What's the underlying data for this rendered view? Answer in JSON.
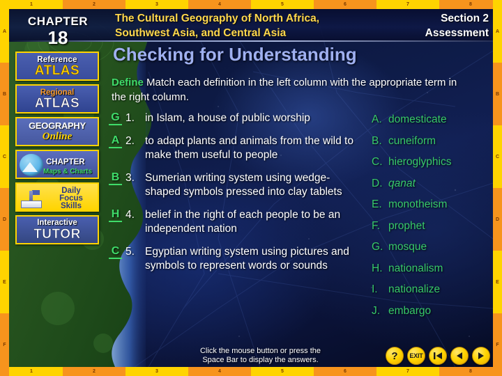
{
  "header": {
    "chapter_word": "CHAPTER",
    "chapter_number": "18",
    "title_line1": "The Cultural Geography of North Africa,",
    "title_line2": "Southwest Asia, and Central Asia",
    "section_line1": "Section 2",
    "section_line2": "Assessment"
  },
  "sidebar": {
    "items": [
      {
        "name": "reference-atlas",
        "line1": "Reference",
        "line2": "ATLAS"
      },
      {
        "name": "regional-atlas",
        "line1": "Regional",
        "line2": "ATLAS"
      },
      {
        "name": "geography-online",
        "line1": "GEOGRAPHY",
        "line2": "Online"
      },
      {
        "name": "chapter-maps-charts",
        "line1": "CHAPTER",
        "line2": "Maps & Charts"
      },
      {
        "name": "daily-focus-skills",
        "line1": "Daily",
        "line2": "Focus",
        "line3": "Skills"
      },
      {
        "name": "interactive-tutor",
        "line1": "Interactive",
        "line2": "TUTOR"
      }
    ]
  },
  "main": {
    "title": "Checking for Understanding",
    "instruction_lead": "Define",
    "instruction_text": "  Match each definition in the left column with the appropriate term in the right column.",
    "definitions": [
      {
        "answer": "G",
        "number": "1.",
        "text": "in Islam, a house of public worship"
      },
      {
        "answer": "A",
        "number": "2.",
        "text": "to adapt plants and animals from the wild to make them useful to people"
      },
      {
        "answer": "B",
        "number": "3.",
        "text": "Sumerian writing system using wedge-shaped symbols pressed into clay tablets"
      },
      {
        "answer": "H",
        "number": "4.",
        "text": "belief in the right of each people to be an independent nation"
      },
      {
        "answer": "C",
        "number": "5.",
        "text": "Egyptian writing system using pictures and symbols to represent words or sounds"
      }
    ],
    "terms": [
      {
        "letter": "A.",
        "term": "domesticate",
        "italic": false
      },
      {
        "letter": "B.",
        "term": "cuneiform",
        "italic": false
      },
      {
        "letter": "C.",
        "term": "hieroglyphics",
        "italic": false
      },
      {
        "letter": "D.",
        "term": "qanat",
        "italic": true
      },
      {
        "letter": "E.",
        "term": "monotheism",
        "italic": false
      },
      {
        "letter": "F.",
        "term": "prophet",
        "italic": false
      },
      {
        "letter": "G.",
        "term": "mosque",
        "italic": false
      },
      {
        "letter": "H.",
        "term": "nationalism",
        "italic": false
      },
      {
        "letter": "I.",
        "term": "nationalize",
        "italic": false
      },
      {
        "letter": "J.",
        "term": "embargo",
        "italic": false
      }
    ]
  },
  "footer": {
    "hint_line1": "Click the mouse button or press the",
    "hint_line2": "Space Bar to display the answers.",
    "nav": [
      {
        "name": "help-button",
        "label": "?",
        "icon": "question-mark-icon"
      },
      {
        "name": "exit-button",
        "label": "EXIT",
        "icon": "exit-icon"
      },
      {
        "name": "first-slide-button",
        "label": "",
        "icon": "skip-to-start-icon"
      },
      {
        "name": "previous-slide-button",
        "label": "",
        "icon": "previous-arrow-icon"
      },
      {
        "name": "next-slide-button",
        "label": "",
        "icon": "next-arrow-icon"
      }
    ]
  },
  "ruler": {
    "top_numbers": [
      "1",
      "2",
      "3",
      "4",
      "5",
      "6",
      "7",
      "8"
    ],
    "bottom_numbers": [
      "1",
      "2",
      "3",
      "4",
      "5",
      "6",
      "7",
      "8"
    ],
    "left_letters": [
      "A",
      "B",
      "C",
      "D",
      "E",
      "F"
    ],
    "right_letters": [
      "A",
      "B",
      "C",
      "D",
      "E",
      "F"
    ]
  },
  "colors": {
    "ruler_yellow": "#ffd400",
    "ruler_orange": "#f7941d",
    "title_blue": "#9fb0f0",
    "header_gold": "#ffd84d",
    "answer_green": "#3fdc6a",
    "term_green": "#37c96a"
  }
}
